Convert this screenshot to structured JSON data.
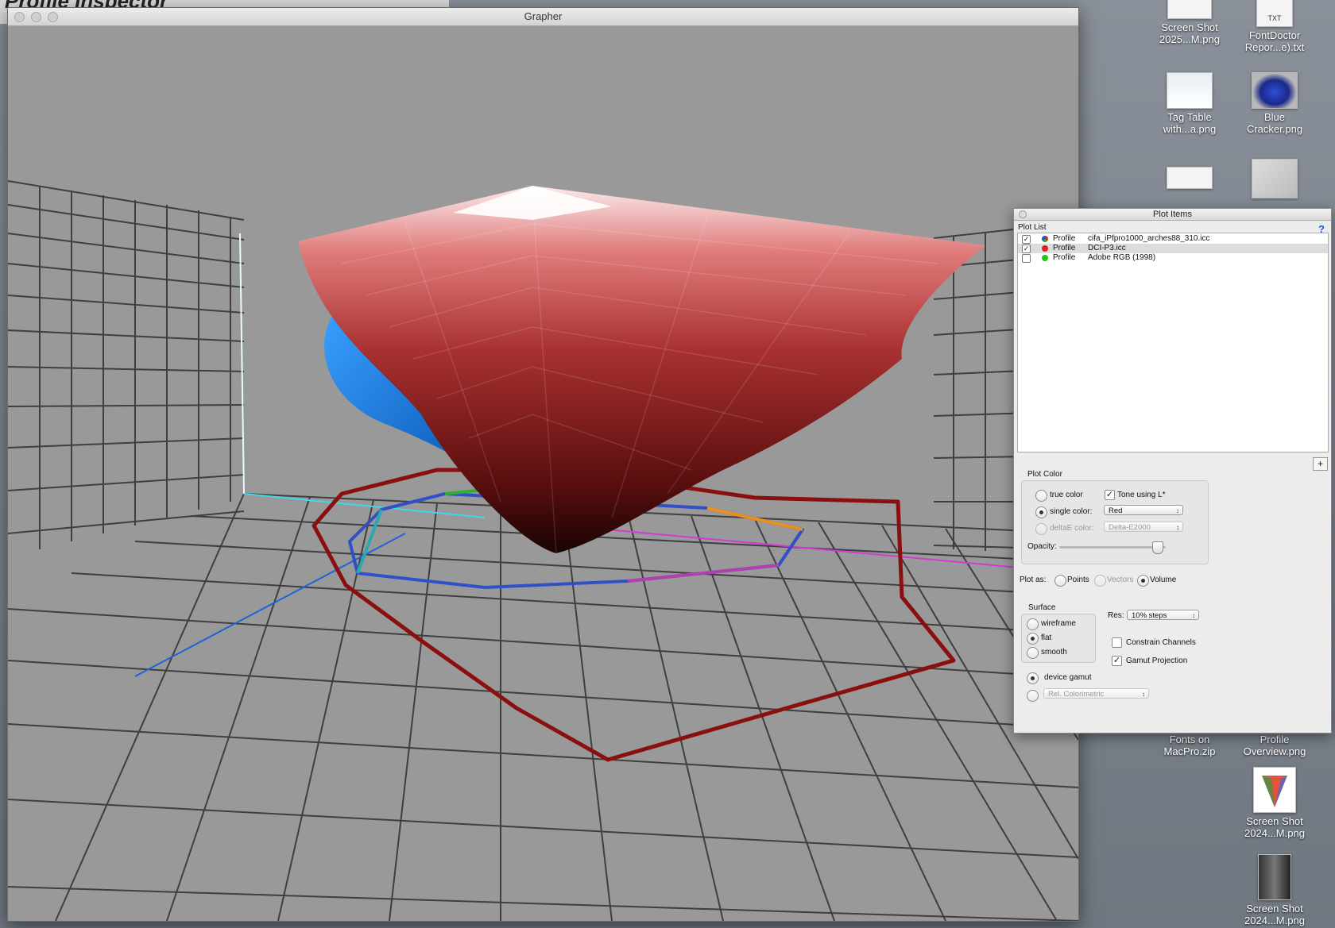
{
  "back_window": {
    "title": "Profile Inspector"
  },
  "grapher": {
    "title": "Grapher"
  },
  "desktop_icons": [
    {
      "line1": "Screen Shot",
      "line2": "2025...M.png"
    },
    {
      "line1": "FontDoctor",
      "line2": "Repor...e).txt",
      "badge": "TXT"
    },
    {
      "line1": "Tag Table",
      "line2": "with...a.png"
    },
    {
      "line1": "Blue",
      "line2": "Cracker.png"
    },
    {
      "line1": "Fonts on",
      "line2": "MacPro.zip"
    },
    {
      "line1": "Profile",
      "line2": "Overview.png"
    },
    {
      "line1": "Screen Shot",
      "line2": "2024...M.png"
    },
    {
      "line1": "Screen Shot",
      "line2": "2024...M.png"
    }
  ],
  "panel": {
    "title": "Plot Items",
    "help": "?",
    "plot_list_label": "Plot List",
    "items": [
      {
        "checked": true,
        "type": "Profile",
        "name": "cifa_iPfpro1000_arches88_310.icc",
        "color": "multi"
      },
      {
        "checked": true,
        "type": "Profile",
        "name": "DCI-P3.icc",
        "color": "#e02020"
      },
      {
        "checked": false,
        "type": "Profile",
        "name": "Adobe RGB (1998)",
        "color": "#22c41e"
      }
    ],
    "add_button": "+",
    "plot_color": {
      "group_label": "Plot Color",
      "true_color": "true color",
      "single_color": "single color:",
      "single_color_value": "Red",
      "deltae_color": "deltaE color:",
      "deltae_value": "Delta-E2000",
      "tone_using": "Tone using L*",
      "tone_checked": true,
      "opacity_label": "Opacity:",
      "opacity_value": 0.92
    },
    "plot_as": {
      "label": "Plot as:",
      "points": "Points",
      "vectors": "Vectors",
      "volume": "Volume"
    },
    "surface": {
      "label": "Surface",
      "wireframe": "wireframe",
      "flat": "flat",
      "smooth": "smooth"
    },
    "res": {
      "label": "Res:",
      "value": "10% steps"
    },
    "constrain": {
      "label": "Constrain Channels",
      "checked": false
    },
    "gamut_projection": {
      "label": "Gamut Projection",
      "checked": true
    },
    "device_gamut": "device gamut",
    "rendering": "Rel. Colorimetric"
  }
}
